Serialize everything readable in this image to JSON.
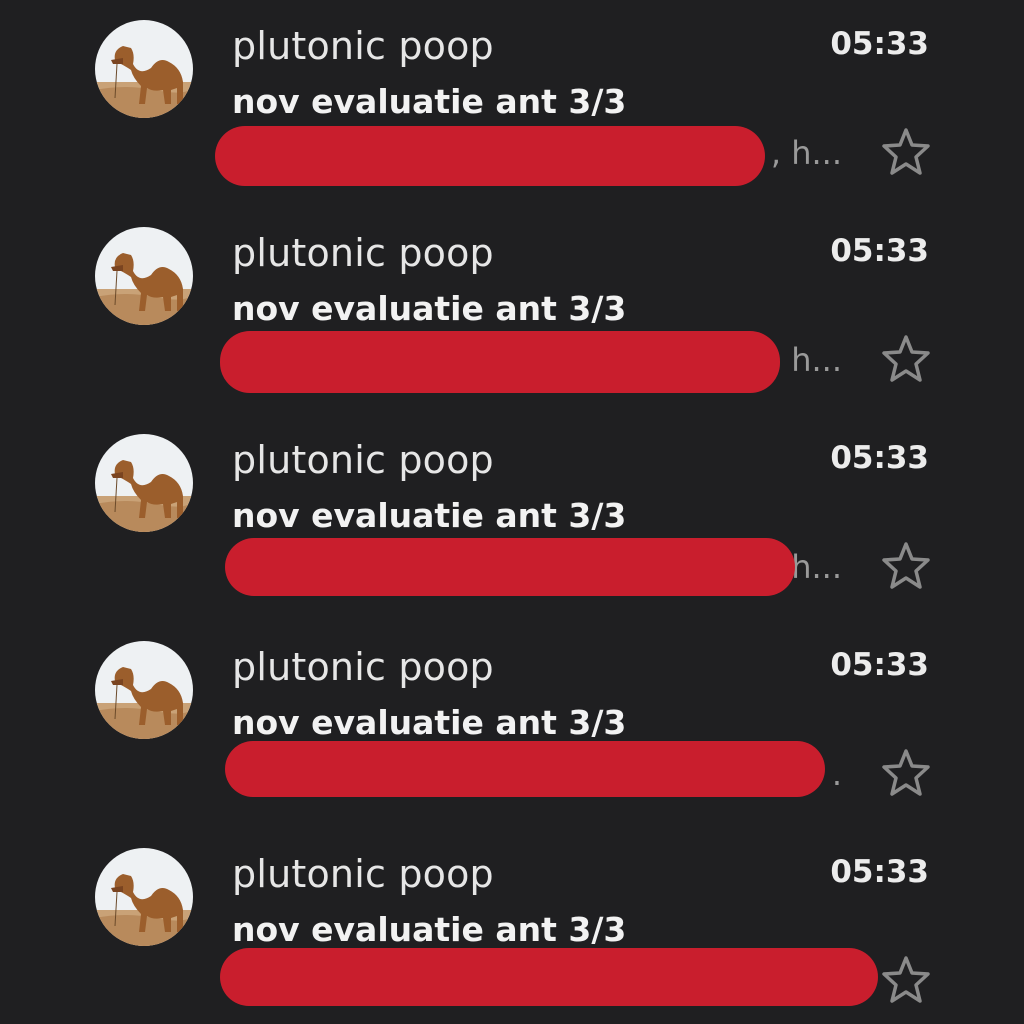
{
  "emails": [
    {
      "sender": "plutonic poop",
      "time": "05:33",
      "subject": "nov evaluatie ant 3/3",
      "snippet_tail": ", h...",
      "starred": false
    },
    {
      "sender": "plutonic poop",
      "time": "05:33",
      "subject": "nov evaluatie ant 3/3",
      "snippet_tail": ", h...",
      "starred": false
    },
    {
      "sender": "plutonic poop",
      "time": "05:33",
      "subject": "nov evaluatie ant 3/3",
      "snippet_tail": "h...",
      "starred": false
    },
    {
      "sender": "plutonic poop",
      "time": "05:33",
      "subject": "nov evaluatie ant 3/3",
      "snippet_tail": ".",
      "starred": false
    },
    {
      "sender": "plutonic poop",
      "time": "05:33",
      "subject": "nov evaluatie ant 3/3",
      "snippet_tail": "",
      "starred": false
    }
  ],
  "colors": {
    "background": "#1f1f21",
    "redaction": "#c91e2d",
    "star_outline": "#8a8a8a"
  },
  "icons": {
    "avatar": "camel-photo-avatar",
    "star": "star-outline-icon"
  }
}
